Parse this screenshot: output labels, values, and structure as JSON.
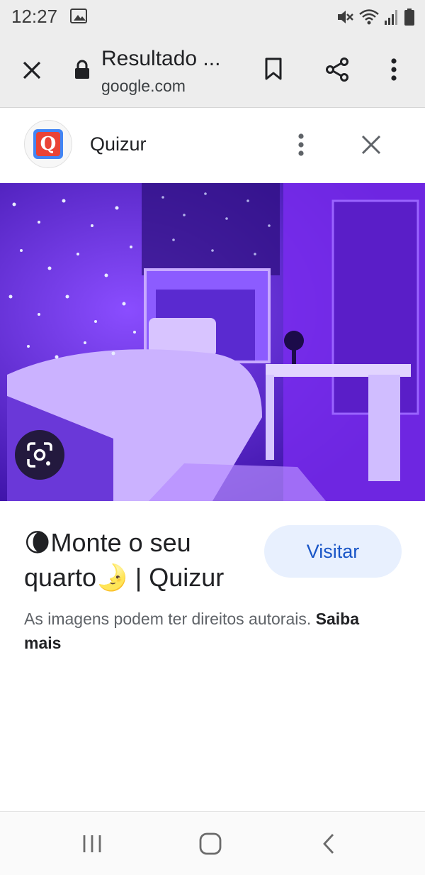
{
  "status_bar": {
    "time": "12:27",
    "icons": [
      "gallery-icon",
      "mute-icon",
      "wifi-icon",
      "signal-icon",
      "battery-icon"
    ]
  },
  "toolbar": {
    "title": "Resultado ...",
    "url": "google.com",
    "icons": [
      "close-icon",
      "lock-icon",
      "bookmark-icon",
      "share-icon",
      "more-vert-icon"
    ]
  },
  "source": {
    "name": "Quizur",
    "favicon_letter": "Q",
    "icons": [
      "more-vert-icon",
      "close-icon"
    ]
  },
  "image": {
    "description_icon": "lens-icon"
  },
  "result": {
    "title_line1": "🌘Monte o seu",
    "title_line2": "quarto🌛 | Quizur",
    "visit_label": "Visitar",
    "copyright_text": "As imagens podem ter direitos autorais.",
    "learn_more": "Saiba mais"
  },
  "navbar": {
    "icons": [
      "recent-apps-icon",
      "home-icon",
      "back-icon"
    ]
  },
  "colors": {
    "accent": "#1a56c7",
    "visit_bg": "#e8f0fe",
    "chrome_bg": "#ededed",
    "photo_purple": "#5a1fd0"
  }
}
